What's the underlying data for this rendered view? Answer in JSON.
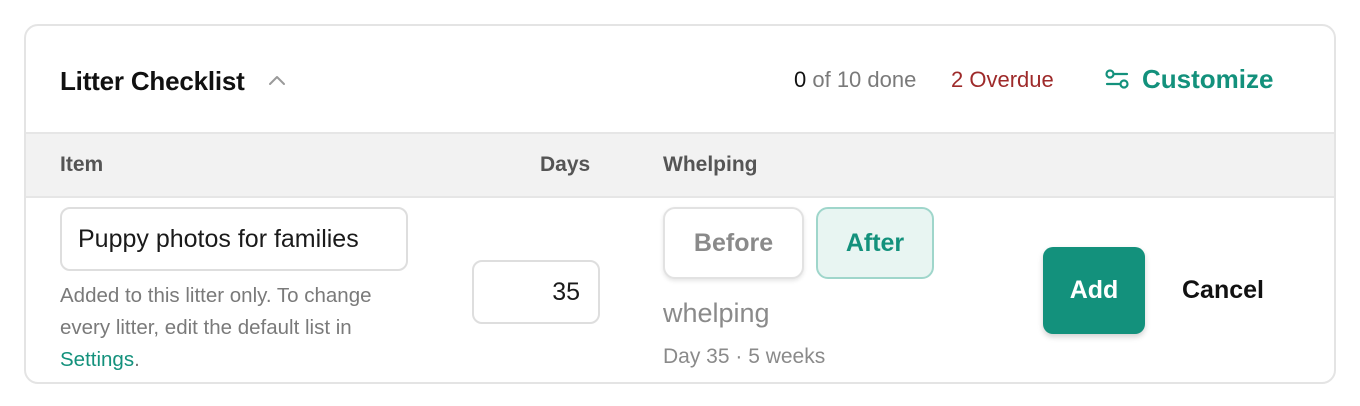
{
  "checklist": {
    "title": "Litter Checklist",
    "done_count": "0",
    "progress_suffix": " of 10 done",
    "overdue_label": "2 Overdue",
    "customize_label": "Customize"
  },
  "table": {
    "headers": {
      "item": "Item",
      "days": "Days",
      "whelping": "Whelping"
    }
  },
  "new_item": {
    "item_value": "Puppy photos for families",
    "help_prefix": "Added to this litter only. To change every litter, edit the default list in ",
    "help_link": "Settings",
    "help_suffix": ".",
    "days_value": "35",
    "timing_options": [
      "Before",
      "After"
    ],
    "timing_selected": "After",
    "reference_label": "whelping",
    "reference_sub": "Day 35 · 5 weeks",
    "add_label": "Add",
    "cancel_label": "Cancel"
  },
  "icons": {
    "collapse": "chevron-up-icon",
    "customize": "sliders-icon"
  },
  "colors": {
    "accent": "#13917c",
    "overdue": "#9e2a2a",
    "selected_bg": "#e8f5f2"
  }
}
